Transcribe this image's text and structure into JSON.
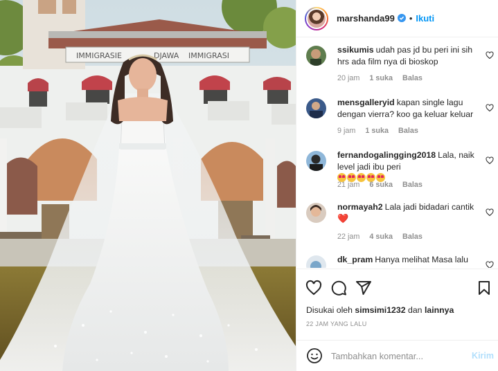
{
  "photo": {
    "alt": "",
    "building_sign_left": "IMMIGRASIE",
    "building_sign_mid": "DJAWA",
    "building_sign_right": "IMMIGRASI"
  },
  "header": {
    "username": "marshanda99",
    "verified": true,
    "separator": "•",
    "follow_label": "Ikuti"
  },
  "comments": [
    {
      "user": "ssikumis",
      "text": "udah pas jd bu peri ini sih hrs ada film nya di bioskop",
      "emoji": "",
      "time": "20 jam",
      "likes": "1 suka",
      "reply": "Balas"
    },
    {
      "user": "mensgalleryid",
      "text": "kapan single lagu dengan vierra? koo ga keluar keluar",
      "emoji": "",
      "time": "9 jam",
      "likes": "1 suka",
      "reply": "Balas"
    },
    {
      "user": "fernandogalingging2018",
      "text": "Lala, naik level jadi ibu peri",
      "emoji": "heart-eyes-x5",
      "time": "21 jam",
      "likes": "6 suka",
      "reply": "Balas"
    },
    {
      "user": "normayah2",
      "text": "Lala jadi bidadari cantik",
      "emoji": "❤️",
      "time": "22 jam",
      "likes": "4 suka",
      "reply": "Balas"
    },
    {
      "user": "dk_pram",
      "text": "Hanya melihat Masa lalu",
      "emoji": "",
      "time": "",
      "likes": "",
      "reply": ""
    }
  ],
  "actions": {
    "like_icon": "heart-outline-icon",
    "comment_icon": "comment-bubble-icon",
    "share_icon": "paper-plane-icon",
    "save_icon": "bookmark-icon"
  },
  "likes": {
    "prefix": "Disukai oleh",
    "user": "simsimi1232",
    "conj": "dan",
    "others": "lainnya"
  },
  "timestamp": "22 JAM YANG LALU",
  "add_comment": {
    "placeholder": "Tambahkan komentar...",
    "post_label": "Kirim"
  },
  "colors": {
    "accent": "#0095f6",
    "post_disabled": "#b2dffc",
    "muted": "#8e8e8e",
    "text": "#262626",
    "heart": "#ed4956"
  }
}
